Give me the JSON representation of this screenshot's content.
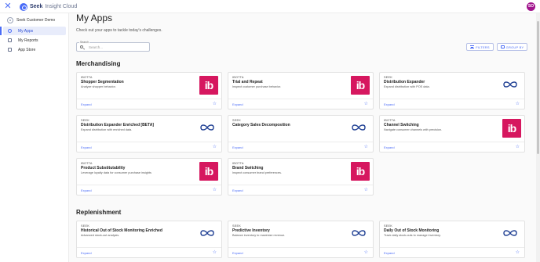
{
  "header": {
    "close_icon": "close-icon",
    "brand_name": "Seek",
    "brand_suffix": "Insight Cloud",
    "avatar_initials": "SO",
    "avatar_color": "#a1148c",
    "accent": "#4a6cf7"
  },
  "sidebar": {
    "org_name": "Seek Customer Demo",
    "items": [
      {
        "label": "My Apps",
        "icon": "lightbulb-icon",
        "active": true
      },
      {
        "label": "My Reports",
        "icon": "report-icon",
        "active": false
      },
      {
        "label": "App Store",
        "icon": "store-icon",
        "active": false
      }
    ]
  },
  "main": {
    "title": "My Apps",
    "subtitle": "Check out your apps to tackle today's challenges.",
    "search": {
      "label": "Search",
      "placeholder": "Search..."
    },
    "filters_label": "FILTERS",
    "group_by_label": "GROUP BY",
    "expand_label": "Expand",
    "sections": [
      {
        "title": "Merchandising",
        "cards": [
          {
            "vendor": "IBOTTA",
            "title": "Shopper Segmentation",
            "desc": "Analyze shopper behavior.",
            "logo": "ib"
          },
          {
            "vendor": "IBOTTA",
            "title": "Trial and Repeat",
            "desc": "Inspect customer purchase behavior.",
            "logo": "ib"
          },
          {
            "vendor": "SEEK",
            "title": "Distribution Expander",
            "desc": "Expand distribution with POS data.",
            "logo": "seek"
          },
          {
            "vendor": "SEEK",
            "title": "Distribution Expander Enriched [BETA]",
            "desc": "Expand distribution with enriched data.",
            "logo": "seek"
          },
          {
            "vendor": "SEEK",
            "title": "Category Sales Decomposition",
            "desc": "",
            "logo": "seek"
          },
          {
            "vendor": "IBOTTA",
            "title": "Channel Switching",
            "desc": "Navigate consumer channels with precision.",
            "logo": "ib"
          },
          {
            "vendor": "IBOTTA",
            "title": "Product Substitutability",
            "desc": "Leverage loyalty data for consumer purchase insights",
            "logo": "ib"
          },
          {
            "vendor": "IBOTTA",
            "title": "Brand Switching",
            "desc": "Inspect consumer brand preferences.",
            "logo": "ib"
          }
        ]
      },
      {
        "title": "Replenishment",
        "cards": [
          {
            "vendor": "SEEK",
            "title": "Historical Out of Stock Monitoring Enriched",
            "desc": "Advanced stock-out analysis.",
            "logo": "seek"
          },
          {
            "vendor": "SEEK",
            "title": "Predictive Inventory",
            "desc": "Balance inventory to maximize revenue.",
            "logo": "seek"
          },
          {
            "vendor": "SEEK",
            "title": "Daily Out of Stock Monitoring",
            "desc": "Track daily stock-outs to manage inventory.",
            "logo": "seek"
          }
        ]
      }
    ]
  }
}
